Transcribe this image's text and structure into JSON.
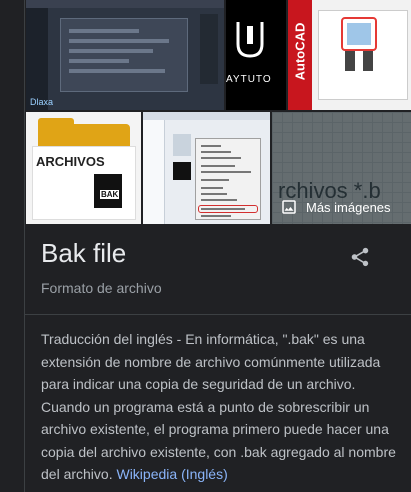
{
  "images": {
    "tile1_logo_text": "Dlaxa",
    "tile2_brand_text": "AYTUTO",
    "tile3_brand_text": "AutoCAD",
    "tile4_folder_label": "ARCHIVOS",
    "tile4_file_badge": "BAK",
    "tile6_background_text": "rchivos *.b",
    "more_images_label": "Más imágenes",
    "more_images_icon": "image-icon"
  },
  "entity": {
    "title": "Bak file",
    "subtitle": "Formato de archivo",
    "share_icon": "share-icon"
  },
  "description": {
    "text": "Traducción del inglés - En informática, \".bak\" es una extensión de nombre de archivo comúnmente utilizada para indicar una copia de seguridad de un archivo. Cuando un programa está a punto de sobrescribir un archivo existente, el programa primero puede hacer una copia del archivo existente, con .bak agregado al nombre del archivo.",
    "link_label": "Wikipedia (Inglés)"
  },
  "colors": {
    "background": "#202124",
    "title": "#e8eaed",
    "text": "#bdc1c6",
    "muted": "#9aa0a6",
    "link": "#8ab4f8"
  }
}
